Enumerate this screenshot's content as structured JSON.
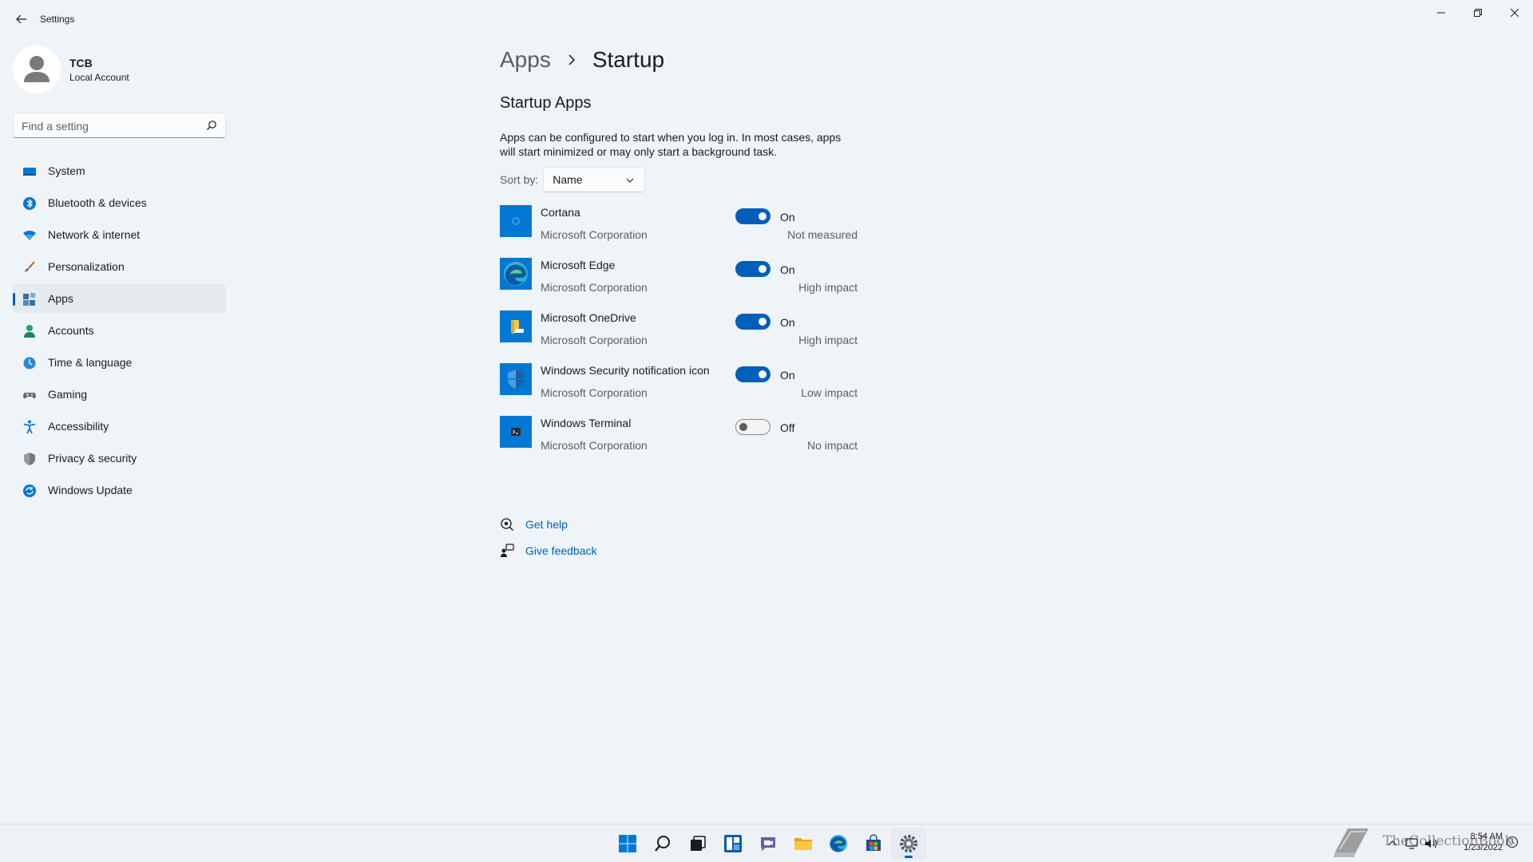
{
  "window": {
    "app_title": "Settings"
  },
  "profile": {
    "name": "TCB",
    "account_type": "Local Account"
  },
  "search": {
    "placeholder": "Find a setting"
  },
  "sidebar": {
    "items": [
      {
        "label": "System",
        "icon": "system-icon",
        "color": "#0078d4"
      },
      {
        "label": "Bluetooth & devices",
        "icon": "bluetooth-icon",
        "color": "#0078d4"
      },
      {
        "label": "Network & internet",
        "icon": "network-icon",
        "color": "#0078d4"
      },
      {
        "label": "Personalization",
        "icon": "brush-icon",
        "color": "#c76a2b"
      },
      {
        "label": "Apps",
        "icon": "apps-icon",
        "color": "#3b6e9c",
        "active": true
      },
      {
        "label": "Accounts",
        "icon": "accounts-icon",
        "color": "#21a366"
      },
      {
        "label": "Time & language",
        "icon": "time-language-icon",
        "color": "#2b88d8"
      },
      {
        "label": "Gaming",
        "icon": "gaming-icon",
        "color": "#6b6b6b"
      },
      {
        "label": "Accessibility",
        "icon": "accessibility-icon",
        "color": "#0078d4"
      },
      {
        "label": "Privacy & security",
        "icon": "shield-icon",
        "color": "#7a7a7a"
      },
      {
        "label": "Windows Update",
        "icon": "update-icon",
        "color": "#0078d4"
      }
    ]
  },
  "breadcrumb": {
    "parent": "Apps",
    "current": "Startup"
  },
  "section": {
    "title": "Startup Apps",
    "description": "Apps can be configured to start when you log in. In most cases, apps will start minimized or may only start a background task."
  },
  "sort": {
    "label": "Sort by:",
    "value": "Name"
  },
  "apps": [
    {
      "name": "Cortana",
      "publisher": "Microsoft Corporation",
      "enabled": true,
      "state": "On",
      "impact": "Not measured",
      "icon": "cortana-icon"
    },
    {
      "name": "Microsoft Edge",
      "publisher": "Microsoft Corporation",
      "enabled": true,
      "state": "On",
      "impact": "High impact",
      "icon": "edge-icon"
    },
    {
      "name": "Microsoft OneDrive",
      "publisher": "Microsoft Corporation",
      "enabled": true,
      "state": "On",
      "impact": "High impact",
      "icon": "onedrive-icon"
    },
    {
      "name": "Windows Security notification icon",
      "publisher": "Microsoft Corporation",
      "enabled": true,
      "state": "On",
      "impact": "Low impact",
      "icon": "windows-security-icon"
    },
    {
      "name": "Windows Terminal",
      "publisher": "Microsoft Corporation",
      "enabled": false,
      "state": "Off",
      "impact": "No impact",
      "icon": "terminal-icon"
    }
  ],
  "help": {
    "get_help": "Get help",
    "give_feedback": "Give feedback"
  },
  "taskbar": {
    "time": "8:54 AM",
    "date": "1/23/2022",
    "icons": [
      "start-icon",
      "search-icon",
      "task-view-icon",
      "widgets-icon",
      "chat-icon",
      "file-explorer-icon",
      "edge-icon",
      "store-icon",
      "settings-icon"
    ]
  },
  "watermark": {
    "text": "TheCollectionBook"
  },
  "colors": {
    "accent": "#005fb8",
    "background": "#eff4f9",
    "tile_blue": "#0078d4"
  }
}
